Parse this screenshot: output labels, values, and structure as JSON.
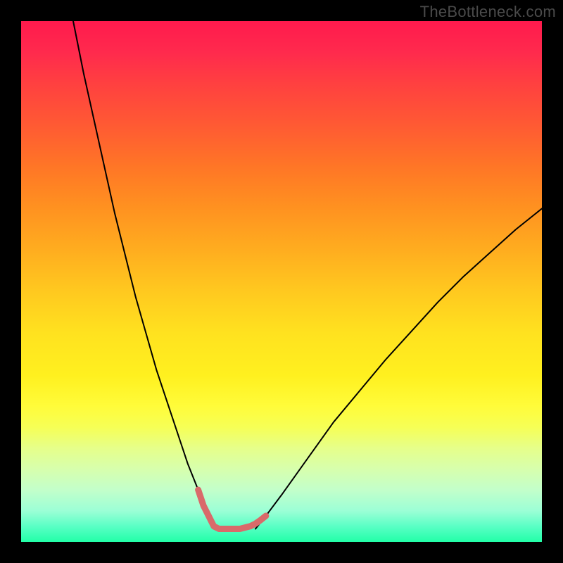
{
  "watermark": "TheBottleneck.com",
  "chart_data": {
    "type": "line",
    "title": "",
    "xlabel": "",
    "ylabel": "",
    "xlim": [
      0,
      100
    ],
    "ylim": [
      0,
      100
    ],
    "gradient_background": {
      "top_color": "#ff1a4d",
      "bottom_color": "#22ffa8",
      "stops": [
        "red",
        "orange",
        "yellow",
        "green"
      ]
    },
    "series": [
      {
        "name": "left-branch",
        "x": [
          10,
          12,
          14,
          16,
          18,
          20,
          22,
          24,
          26,
          28,
          30,
          32,
          34,
          36,
          37
        ],
        "y": [
          100,
          90,
          81,
          72,
          63,
          55,
          47,
          40,
          33,
          27,
          21,
          15,
          10,
          5,
          2.5
        ],
        "color": "#000000",
        "width": 2
      },
      {
        "name": "right-branch",
        "x": [
          45,
          47,
          50,
          55,
          60,
          65,
          70,
          75,
          80,
          85,
          90,
          95,
          100
        ],
        "y": [
          2.5,
          5,
          9,
          16,
          23,
          29,
          35,
          40.5,
          46,
          51,
          55.5,
          60,
          64
        ],
        "color": "#000000",
        "width": 2
      },
      {
        "name": "highlight-segment",
        "x": [
          34,
          35,
          36,
          37,
          38,
          40,
          42,
          44,
          45,
          46,
          47
        ],
        "y": [
          10,
          7,
          5,
          3,
          2.5,
          2.5,
          2.5,
          3,
          3.5,
          4.2,
          5
        ],
        "color": "#d96a6a",
        "width": 9
      }
    ],
    "annotations": []
  }
}
